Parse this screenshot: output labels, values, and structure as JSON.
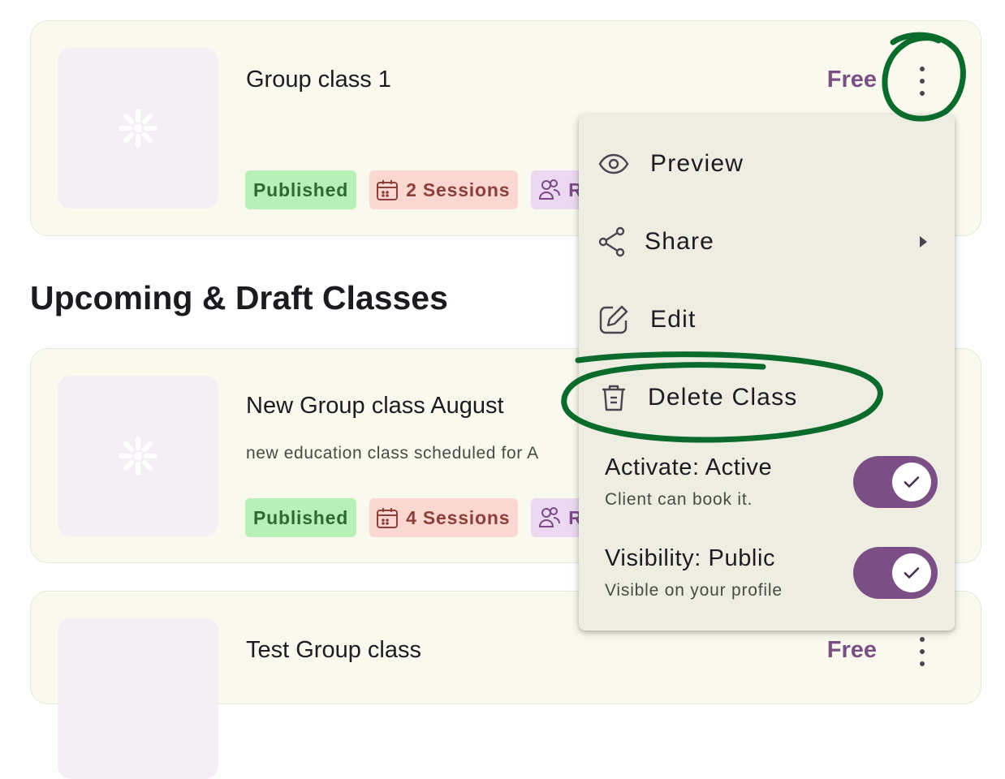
{
  "colors": {
    "accent": "#7b4f85",
    "card_bg": "#f9f9ee",
    "published_bg": "#b9efb9",
    "sessions_bg": "#fbd7d2",
    "role_bg": "#ead9f0",
    "annotation": "#0b6b2c"
  },
  "section": {
    "title": "Upcoming & Draft Classes"
  },
  "classes": [
    {
      "title": "Group class 1",
      "description": "",
      "price": "Free",
      "status": "Published",
      "sessions": "2 Sessions",
      "role_chip": "R"
    },
    {
      "title": "New Group class August",
      "description": "new education class scheduled for A",
      "status": "Published",
      "sessions": "4 Sessions",
      "role_chip": "R"
    },
    {
      "title": "Test Group class",
      "price": "Free"
    }
  ],
  "menu": {
    "items": [
      {
        "label": "Preview",
        "icon": "eye-icon"
      },
      {
        "label": "Share",
        "icon": "share-icon",
        "submenu": true
      },
      {
        "label": "Edit",
        "icon": "edit-icon"
      },
      {
        "label": "Delete Class",
        "icon": "trash-icon"
      }
    ],
    "settings": [
      {
        "title": "Activate: Active",
        "subtitle": "Client can book it.",
        "enabled": true
      },
      {
        "title": "Visibility: Public",
        "subtitle": "Visible on your profile",
        "enabled": true
      }
    ]
  }
}
